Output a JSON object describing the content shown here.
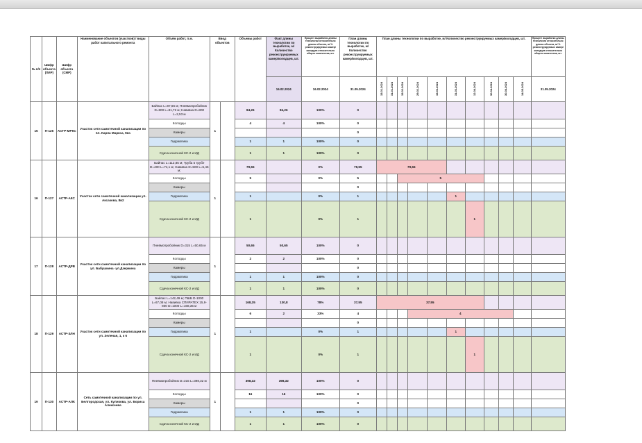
{
  "header": {
    "num": "№ п/п",
    "pir": "Шифр объекта (ПИР)",
    "smr": "Шифр объекта (СМР)",
    "name": "Наименование объектов (участков) / виды работ капитального ремонта",
    "volume": "Объём работ, п.м.",
    "commissioning": "Ввод объектов",
    "work_volume": "Объемы работ",
    "fact": "Факт длины технологии по выработке, м/ Количество реконструируемых камер/колодцев, шт.",
    "remaining_pct": "Процент выработки длины технологии относительно длины объекта, м/ % реконструируемых камер/колодцев относительно общего количества, шт.",
    "plan": "План длины технологии по выработке, м/ Количество реконструируемых камер/колодцев, шт.",
    "schedule": "План длины технологии по выработке, м/ Количество реконструируемых камер/колодцев, шт.",
    "final_pct": "Процент выработки длины технологии относительно длины объекта, м/ % реконструируемых камер/колодцев относительно общего количества, шт.",
    "date_fact": "16.02.2024",
    "date_pct": "16.02.2024",
    "date_plan": "31.05.2024",
    "date_final": "31.05.2024",
    "dates": [
      "15.01.2024",
      "31.01.2024",
      "15.02.2024",
      "29.02.2024",
      "15.03.2024",
      "31.03.2024",
      "12.04.2024",
      "30.04.2024",
      "30.04.2024",
      "14.05.2024"
    ]
  },
  "objects": [
    {
      "num": "15",
      "pir": "П-126",
      "smr": "АСТР-МРКС",
      "name": "Участок сети самотечной канализации по пл. Карла Маркса, 92а",
      "commissioning": "1",
      "rows": [
        {
          "label": "Байпас L=87,66 м; Пневмопробойник D=800 L=81,72 м; Навивка D=800 L=2,53 м",
          "vol": "84,26",
          "fact": "84,26",
          "pct": "100%",
          "plan": "0"
        },
        {
          "label": "Колодцы",
          "vol": "4",
          "fact": "4",
          "pct": "100%",
          "plan": "0"
        },
        {
          "label": "Камеры",
          "vol": "",
          "fact": "",
          "pct": "",
          "plan": "0"
        },
        {
          "label": "Гидравлика",
          "vol": "1",
          "fact": "1",
          "pct": "100%",
          "plan": "0"
        },
        {
          "label": "Сдача конечной КС-2 и ИД",
          "vol": "1",
          "fact": "1",
          "pct": "100%",
          "plan": "0"
        }
      ]
    },
    {
      "num": "16",
      "pir": "П-127",
      "smr": "АСТР-АКС",
      "name": "Участок сети самотечной канализации ул. Аксакова, 8в2",
      "commissioning": "1",
      "rows": [
        {
          "label": "Байпас L=112,85 м; Труба в трубе D=400 L=74,1 м; Навивка D=500 L=5,45 м;",
          "vol": "79,55",
          "fact": "",
          "pct": "0%",
          "plan": "79,55",
          "sched": "79,55"
        },
        {
          "label": "Колодцы",
          "vol": "5",
          "fact": "",
          "pct": "0%",
          "plan": "5",
          "sched": "5"
        },
        {
          "label": "Камеры",
          "vol": "",
          "fact": "",
          "pct": "",
          "plan": "0"
        },
        {
          "label": "Гидравлика",
          "vol": "1",
          "fact": "",
          "pct": "0%",
          "plan": "1",
          "sched": "1"
        },
        {
          "label": "Сдача конечной КС-2 и ИД",
          "vol": "1",
          "fact": "",
          "pct": "0%",
          "plan": "1",
          "sched": "1"
        }
      ]
    },
    {
      "num": "17",
      "pir": "П-128",
      "smr": "АСТР-ДРВ",
      "name": "Участок сети самотечной канализации по ул. Бабушкина -ул.Дзержина",
      "commissioning": "1",
      "rows": [
        {
          "label": "Пневмопробойник D=315 L=50,65 м",
          "vol": "50,65",
          "fact": "50,65",
          "pct": "100%",
          "plan": "0"
        },
        {
          "label": "Колодцы",
          "vol": "2",
          "fact": "2",
          "pct": "100%",
          "plan": "0"
        },
        {
          "label": "Камеры",
          "vol": "",
          "fact": "",
          "pct": "",
          "plan": "0"
        },
        {
          "label": "Гидравлика",
          "vol": "1",
          "fact": "1",
          "pct": "100%",
          "plan": "0"
        },
        {
          "label": "Сдача конечной КС-2 и ИД",
          "vol": "1",
          "fact": "1",
          "pct": "100%",
          "plan": "0"
        }
      ]
    },
    {
      "num": "18",
      "pir": "П-129",
      "smr": "АСТР-ЗЛН",
      "name": "Участок сети самотечной канализации по ул. Зеленая, 1, к 6",
      "commissioning": "1",
      "rows": [
        {
          "label": "Байпас L=142,49 м; ПШБ D-1000 L=67,08 м; Навивка СПИРАТЕХ 15,9-800 D=1000 L=168,35 м",
          "vol": "168,35",
          "fact": "130,8",
          "pct": "78%",
          "plan": "37,55",
          "sched": "37,55"
        },
        {
          "label": "Колодцы",
          "vol": "6",
          "fact": "2",
          "pct": "33%",
          "plan": "4",
          "sched": "4"
        },
        {
          "label": "Камеры",
          "vol": "",
          "fact": "",
          "pct": "",
          "plan": "0"
        },
        {
          "label": "Гидравлика",
          "vol": "1",
          "fact": "",
          "pct": "0%",
          "plan": "1",
          "sched": "1"
        },
        {
          "label": "Сдача конечной КС-2 и ИД",
          "vol": "1",
          "fact": "",
          "pct": "0%",
          "plan": "1",
          "sched": "1"
        }
      ]
    },
    {
      "num": "19",
      "pir": "П-130",
      "smr": "АСТР-АЛК",
      "name": "Сеть самотечной канализации по ул. Белгородская, ул. Куликова, ул. Бориса Алексеева",
      "commissioning": "1",
      "rows": [
        {
          "label": "Пневмопробойник D=315 L=398,32 м",
          "vol": "398,32",
          "fact": "398,32",
          "pct": "100%",
          "plan": "0"
        },
        {
          "label": "Колодцы",
          "vol": "16",
          "fact": "16",
          "pct": "100%",
          "plan": "0"
        },
        {
          "label": "Камеры",
          "vol": "",
          "fact": "",
          "pct": "",
          "plan": "0"
        },
        {
          "label": "Гидравлика",
          "vol": "1",
          "fact": "1",
          "pct": "100%",
          "plan": "0"
        },
        {
          "label": "Сдача конечной КС-2 и ИД",
          "vol": "1",
          "fact": "1",
          "pct": "100%",
          "plan": "0"
        }
      ]
    }
  ]
}
